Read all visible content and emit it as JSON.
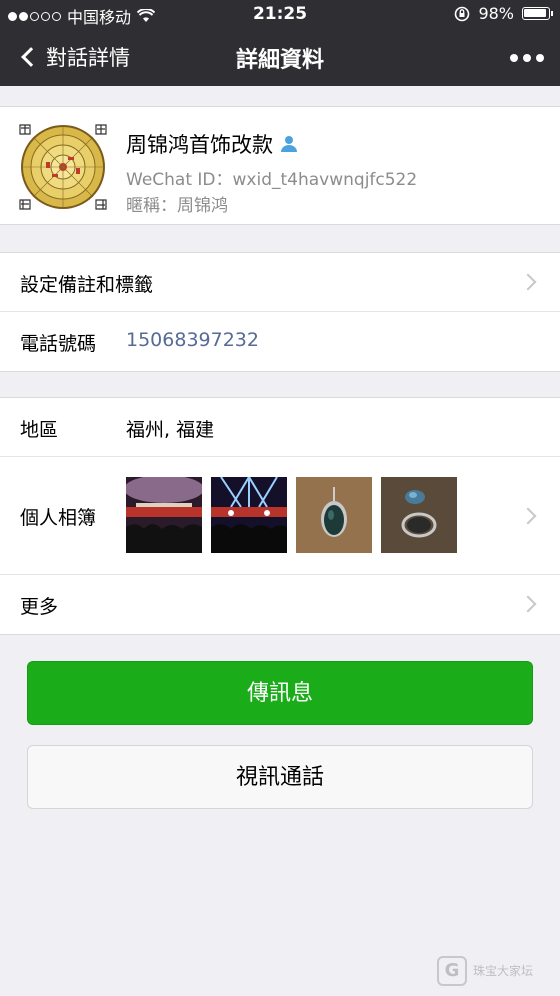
{
  "status_bar": {
    "carrier": "中国移动",
    "time": "21:25",
    "battery": "98%"
  },
  "nav": {
    "back_label": "對話詳情",
    "title": "詳細資料"
  },
  "profile": {
    "name": "周锦鸿首饰改款",
    "wechat_id": "WeChat ID：wxid_t4havwnqjfc522",
    "nickname": "暱稱：周锦鸿"
  },
  "rows": {
    "remark": "設定備註和標籤",
    "phone_label": "電話號碼",
    "phone_value": "15068397232",
    "region_label": "地區",
    "region_value": "福州, 福建",
    "album_label": "個人相簿",
    "more_label": "更多"
  },
  "buttons": {
    "message": "傳訊息",
    "video_call": "視訊通話"
  },
  "watermark": {
    "line1": "珠宝大家坛",
    "line2": ""
  },
  "colors": {
    "nav_bg": "#2f2f33",
    "accent_green": "#1aad19",
    "link_blue": "#576b95"
  }
}
